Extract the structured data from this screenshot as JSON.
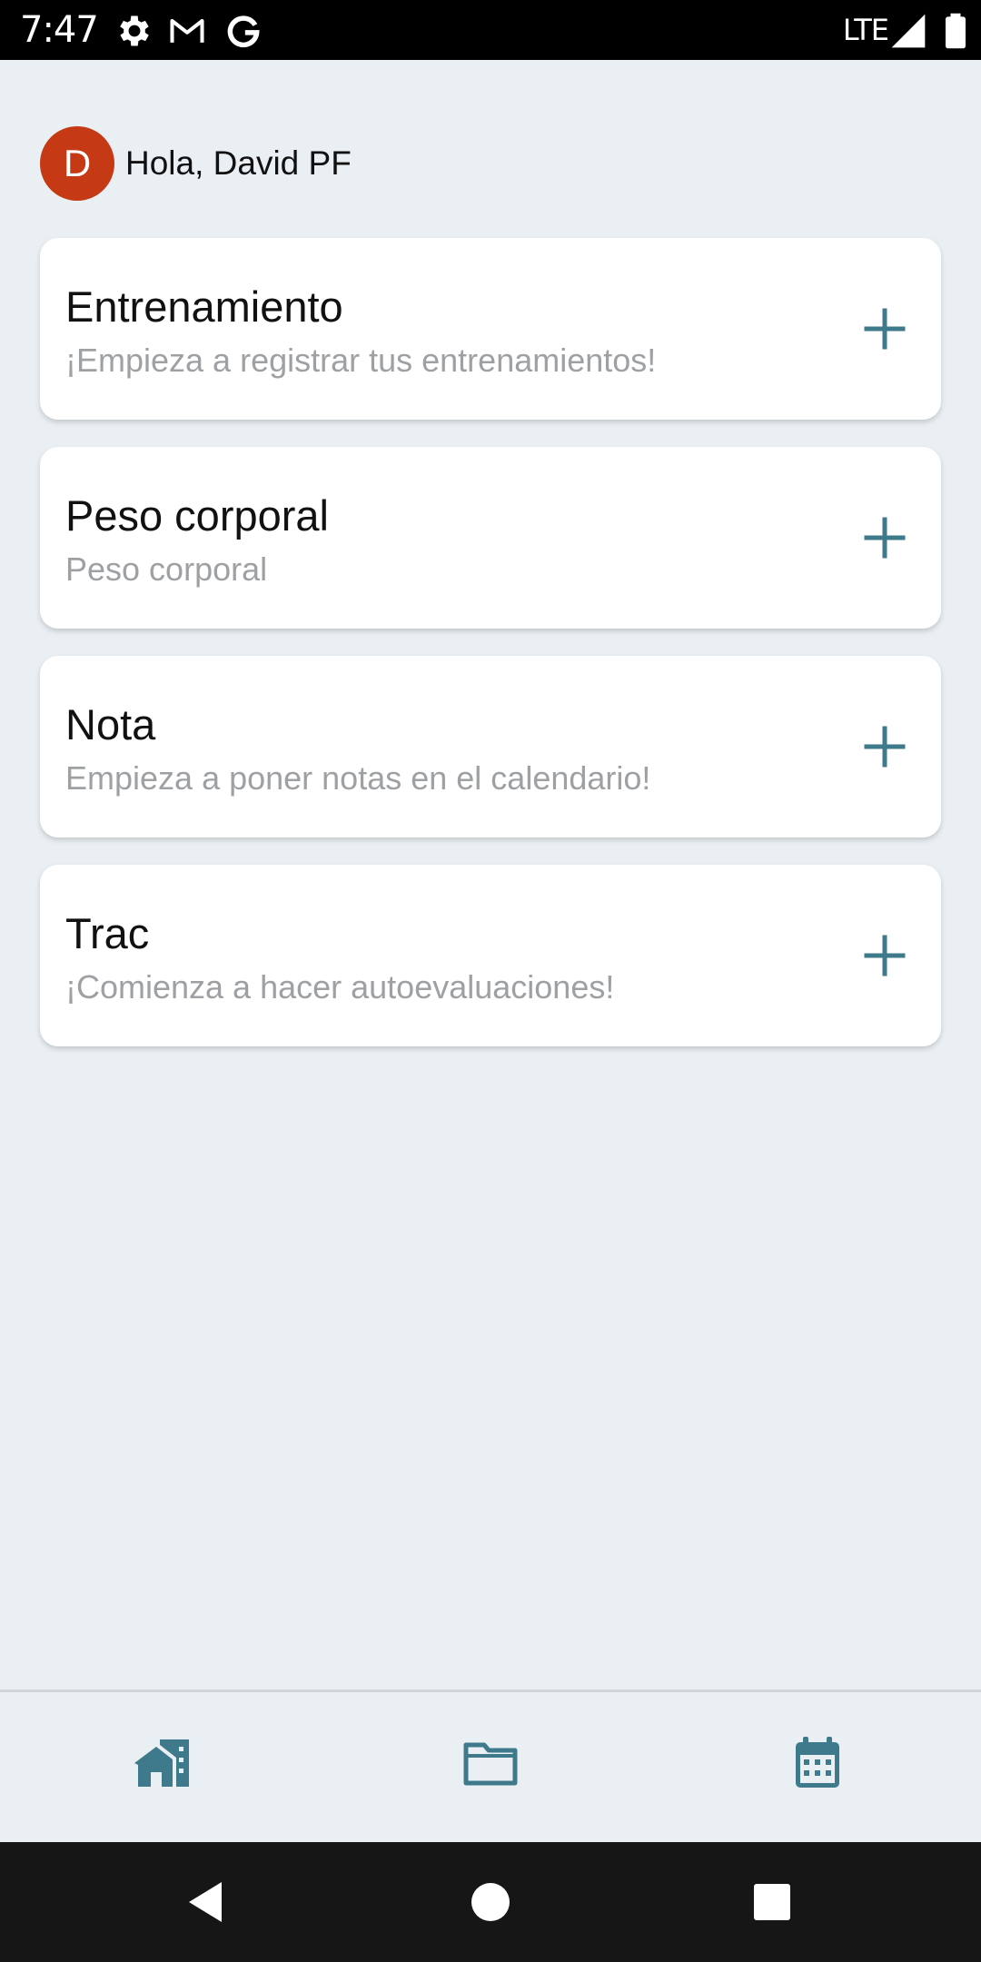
{
  "status_bar": {
    "time": "7:47",
    "network": "LTE",
    "icons": [
      "gear-icon",
      "gmail-icon",
      "google-icon",
      "signal-icon",
      "battery-icon"
    ]
  },
  "greeting": {
    "avatar_letter": "D",
    "text": "Hola, David PF"
  },
  "cards": [
    {
      "title": "Entrenamiento",
      "subtitle": "¡Empieza a registrar tus entrenamientos!"
    },
    {
      "title": "Peso corporal",
      "subtitle": "Peso corporal"
    },
    {
      "title": "Nota",
      "subtitle": "Empieza a poner notas en el calendario!"
    },
    {
      "title": "Trac",
      "subtitle": "¡Comienza a hacer autoevaluaciones!"
    }
  ],
  "bottom_nav": {
    "items": [
      "home-icon",
      "folder-icon",
      "calendar-icon"
    ]
  },
  "colors": {
    "accent": "#3f7a8c",
    "avatar": "#c53a14",
    "background": "#e9eff2",
    "subtitle": "#9ea1a4"
  }
}
